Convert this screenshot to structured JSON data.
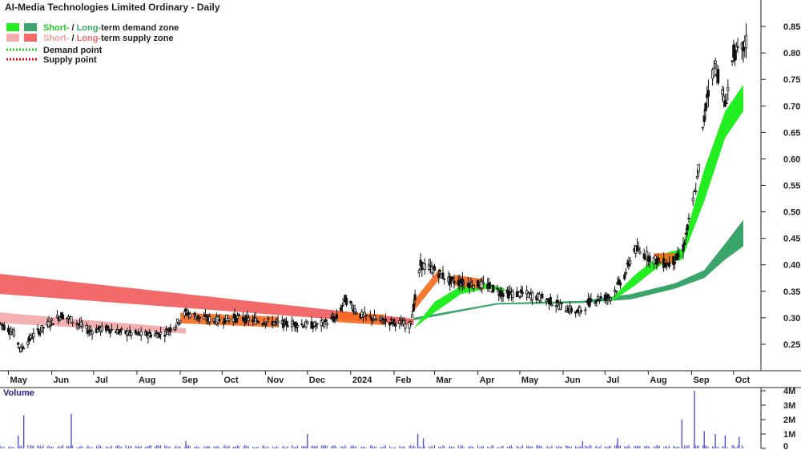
{
  "chart_data": {
    "type": "candlestick",
    "title": "AI-Media Technologies Limited Ordinary - Daily",
    "colors": {
      "short_demand": "#22ee22",
      "long_demand": "#3aa56a",
      "short_supply": "#f4b0b0",
      "long_supply": "#f26a6a",
      "overlap_orange": "#f46a1e",
      "demand_point": "#22cc22",
      "supply_point": "#e01010",
      "volume": "#5050c8"
    },
    "legend": [
      {
        "prefix": "Short-",
        "mid": " / ",
        "word": "Long-",
        "suffix": "term demand zone",
        "kind": "demand"
      },
      {
        "prefix": "Short-",
        "mid": " / ",
        "word": "Long-",
        "suffix": "term supply zone",
        "kind": "supply"
      },
      {
        "label": "Demand point",
        "kind": "demand_point"
      },
      {
        "label": "Supply point",
        "kind": "supply_point"
      }
    ],
    "ylim": [
      0.2,
      0.9
    ],
    "y_ticks": [
      {
        "v": 0.85,
        "label": "0.85"
      },
      {
        "v": 0.8,
        "label": "0.80"
      },
      {
        "v": 0.75,
        "label": "0.75"
      },
      {
        "v": 0.7,
        "label": "0.70"
      },
      {
        "v": 0.65,
        "label": "0.65"
      },
      {
        "v": 0.6,
        "label": "0.60"
      },
      {
        "v": 0.55,
        "label": "0.55"
      },
      {
        "v": 0.5,
        "label": "0.50"
      },
      {
        "v": 0.45,
        "label": "0.45"
      },
      {
        "v": 0.4,
        "label": "0.40"
      },
      {
        "v": 0.35,
        "label": "0.35"
      },
      {
        "v": 0.3,
        "label": "0.30"
      },
      {
        "v": 0.25,
        "label": "0.25"
      }
    ],
    "x_labels": [
      {
        "date": "2023-05-01",
        "label": "May"
      },
      {
        "date": "2023-06-01",
        "label": "Jun"
      },
      {
        "date": "2023-07-01",
        "label": "Jul"
      },
      {
        "date": "2023-08-01",
        "label": "Aug"
      },
      {
        "date": "2023-09-01",
        "label": "Sep"
      },
      {
        "date": "2023-10-01",
        "label": "Oct"
      },
      {
        "date": "2023-11-01",
        "label": "Nov"
      },
      {
        "date": "2023-12-01",
        "label": "Dec"
      },
      {
        "date": "2024-01-01",
        "label": "2024"
      },
      {
        "date": "2024-02-01",
        "label": "Feb"
      },
      {
        "date": "2024-03-01",
        "label": "Mar"
      },
      {
        "date": "2024-04-01",
        "label": "Apr"
      },
      {
        "date": "2024-05-01",
        "label": "May"
      },
      {
        "date": "2024-06-01",
        "label": "Jun"
      },
      {
        "date": "2024-07-01",
        "label": "Jul"
      },
      {
        "date": "2024-08-01",
        "label": "Aug"
      },
      {
        "date": "2024-09-01",
        "label": "Sep"
      },
      {
        "date": "2024-10-01",
        "label": "Oct"
      }
    ],
    "x_range": [
      "2023-04-25",
      "2024-10-12"
    ],
    "close_series": [
      [
        "2023-04-25",
        0.29
      ],
      [
        "2023-05-05",
        0.27
      ],
      [
        "2023-05-10",
        0.24
      ],
      [
        "2023-05-18",
        0.265
      ],
      [
        "2023-05-28",
        0.285
      ],
      [
        "2023-06-08",
        0.305
      ],
      [
        "2023-06-16",
        0.295
      ],
      [
        "2023-06-28",
        0.275
      ],
      [
        "2023-07-10",
        0.28
      ],
      [
        "2023-07-22",
        0.272
      ],
      [
        "2023-08-05",
        0.268
      ],
      [
        "2023-08-20",
        0.27
      ],
      [
        "2023-08-28",
        0.285
      ],
      [
        "2023-09-05",
        0.31
      ],
      [
        "2023-09-15",
        0.3
      ],
      [
        "2023-09-28",
        0.295
      ],
      [
        "2023-10-10",
        0.3
      ],
      [
        "2023-10-25",
        0.295
      ],
      [
        "2023-11-10",
        0.29
      ],
      [
        "2023-11-25",
        0.288
      ],
      [
        "2023-12-08",
        0.285
      ],
      [
        "2023-12-22",
        0.3
      ],
      [
        "2023-12-28",
        0.335
      ],
      [
        "2024-01-08",
        0.305
      ],
      [
        "2024-01-22",
        0.295
      ],
      [
        "2024-02-05",
        0.29
      ],
      [
        "2024-02-12",
        0.285
      ],
      [
        "2024-02-15",
        0.32
      ],
      [
        "2024-02-20",
        0.4
      ],
      [
        "2024-03-01",
        0.39
      ],
      [
        "2024-03-12",
        0.37
      ],
      [
        "2024-03-25",
        0.365
      ],
      [
        "2024-04-08",
        0.36
      ],
      [
        "2024-04-20",
        0.345
      ],
      [
        "2024-05-05",
        0.345
      ],
      [
        "2024-05-20",
        0.335
      ],
      [
        "2024-06-01",
        0.32
      ],
      [
        "2024-06-12",
        0.31
      ],
      [
        "2024-06-22",
        0.335
      ],
      [
        "2024-07-05",
        0.34
      ],
      [
        "2024-07-15",
        0.38
      ],
      [
        "2024-07-22",
        0.43
      ],
      [
        "2024-08-05",
        0.41
      ],
      [
        "2024-08-15",
        0.4
      ],
      [
        "2024-08-25",
        0.42
      ],
      [
        "2024-08-30",
        0.48
      ],
      [
        "2024-09-05",
        0.56
      ],
      [
        "2024-09-12",
        0.72
      ],
      [
        "2024-09-18",
        0.78
      ],
      [
        "2024-09-25",
        0.7
      ],
      [
        "2024-10-01",
        0.8
      ],
      [
        "2024-10-06",
        0.8
      ],
      [
        "2024-10-10",
        0.82
      ]
    ],
    "zones": {
      "long_supply": {
        "start": "2023-04-25",
        "end": "2024-02-15",
        "upper_from": 0.383,
        "upper_to": 0.298,
        "lower_from": 0.345,
        "lower_to": 0.286
      },
      "short_supply": {
        "start": "2023-04-25",
        "end": "2023-09-05",
        "upper_from": 0.31,
        "upper_to": 0.28,
        "lower_from": 0.29,
        "lower_to": 0.27
      },
      "short_demand_1": [
        [
          "2024-02-15",
          0.28,
          0.28
        ],
        [
          "2024-03-01",
          0.31,
          0.33
        ],
        [
          "2024-03-20",
          0.345,
          0.36
        ],
        [
          "2024-04-08",
          0.355,
          0.365
        ],
        [
          "2024-04-20",
          0.35,
          0.355
        ]
      ],
      "short_demand_2": [
        [
          "2024-07-05",
          0.33,
          0.335
        ],
        [
          "2024-07-22",
          0.36,
          0.38
        ],
        [
          "2024-08-10",
          0.4,
          0.42
        ],
        [
          "2024-08-25",
          0.41,
          0.43
        ],
        [
          "2024-09-10",
          0.52,
          0.58
        ],
        [
          "2024-09-25",
          0.64,
          0.69
        ],
        [
          "2024-10-08",
          0.69,
          0.74
        ]
      ],
      "long_demand": [
        [
          "2024-02-15",
          0.295,
          0.3
        ],
        [
          "2024-04-15",
          0.325,
          0.328
        ],
        [
          "2024-06-15",
          0.328,
          0.332
        ],
        [
          "2024-07-20",
          0.335,
          0.345
        ],
        [
          "2024-08-20",
          0.355,
          0.365
        ],
        [
          "2024-09-10",
          0.375,
          0.39
        ],
        [
          "2024-09-25",
          0.41,
          0.44
        ],
        [
          "2024-10-08",
          0.435,
          0.485
        ]
      ],
      "orange_segments": [
        [
          "2023-09-01",
          "2023-11-10"
        ],
        [
          "2023-12-22",
          "2024-01-25"
        ],
        [
          "2024-02-15",
          "2024-03-05"
        ],
        [
          "2024-03-15",
          "2024-04-05"
        ],
        [
          "2024-08-05",
          "2024-08-20"
        ]
      ]
    },
    "volume": {
      "label": "Volume",
      "ylim": [
        0,
        4000000
      ],
      "y_ticks": [
        {
          "v": 4000000,
          "label": "4M"
        },
        {
          "v": 3000000,
          "label": "3M"
        },
        {
          "v": 2000000,
          "label": "2M"
        },
        {
          "v": 1000000,
          "label": "1M"
        },
        {
          "v": 0,
          "label": "0"
        }
      ],
      "spikes": [
        [
          "2023-05-12",
          2300000
        ],
        [
          "2023-06-15",
          2400000
        ],
        [
          "2023-05-08",
          900000
        ],
        [
          "2023-09-05",
          500000
        ],
        [
          "2023-12-01",
          1000000
        ],
        [
          "2024-02-18",
          1000000
        ],
        [
          "2024-02-22",
          700000
        ],
        [
          "2024-06-15",
          500000
        ],
        [
          "2024-07-10",
          700000
        ],
        [
          "2024-08-25",
          2000000
        ],
        [
          "2024-09-03",
          4000000
        ],
        [
          "2024-09-10",
          1200000
        ],
        [
          "2024-09-18",
          1000000
        ],
        [
          "2024-09-25",
          900000
        ],
        [
          "2024-10-05",
          800000
        ]
      ],
      "base_level": 150000
    }
  }
}
